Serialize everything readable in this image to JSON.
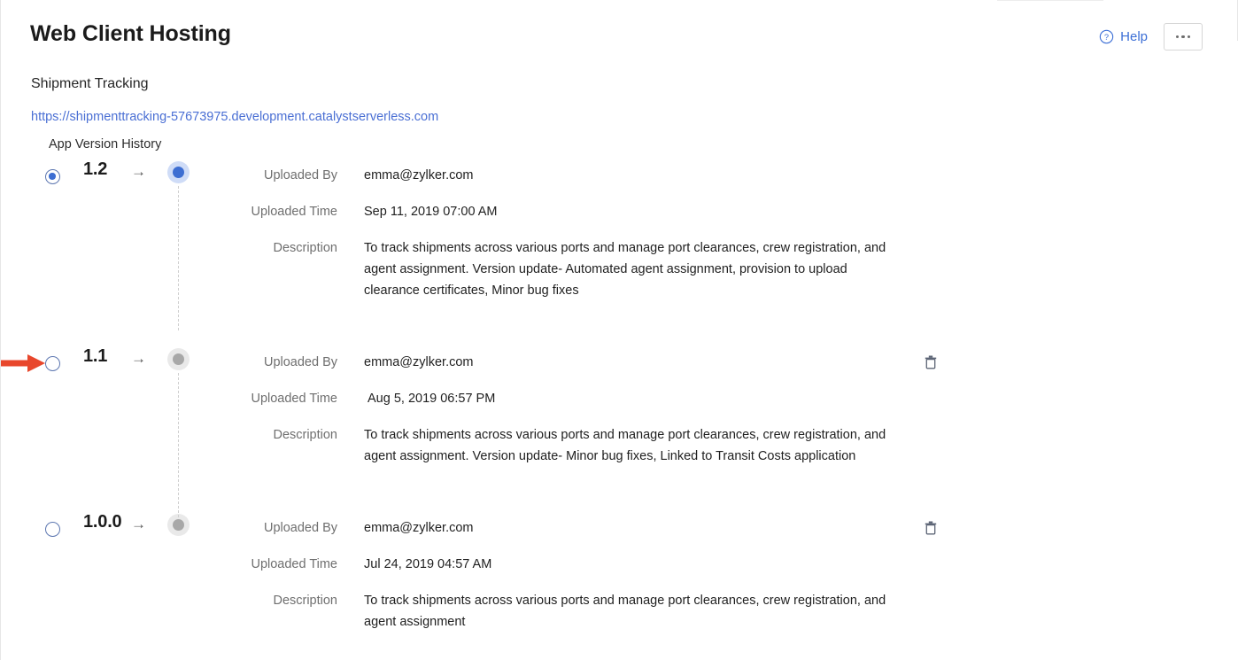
{
  "header": {
    "title": "Web Client Hosting",
    "help_label": "Help",
    "help_icon": "question-circle-icon",
    "more_icon": "ellipsis-icon"
  },
  "app": {
    "name": "Shipment Tracking",
    "url": "https://shipmenttracking-57673975.development.catalystserverless.com",
    "section_label": "App Version History"
  },
  "labels": {
    "uploaded_by": "Uploaded By",
    "uploaded_time": "Uploaded Time",
    "description": "Description",
    "arrow_glyph": "→",
    "delete_icon": "trash-icon"
  },
  "colors": {
    "link": "#4a6fd4",
    "accent": "#3d6ed2",
    "annotation": "#e8472c",
    "label_text": "#6f6f6f",
    "idle_dot": "#a8a8a8"
  },
  "versions": [
    {
      "version": "1.2",
      "selected": true,
      "active_dot": true,
      "uploaded_by": "emma@zylker.com",
      "uploaded_time": "Sep 11, 2019 07:00 AM",
      "description": "To track shipments across various ports and manage port clearances, crew registration, and agent assignment. Version update- Automated agent assignment, provision to upload clearance certificates, Minor bug fixes",
      "deletable": false,
      "annotated": false
    },
    {
      "version": "1.1",
      "selected": false,
      "active_dot": false,
      "uploaded_by": "emma@zylker.com",
      "uploaded_time": "Aug 5, 2019 06:57 PM",
      "description": "To track shipments across various ports and manage port clearances, crew registration, and agent assignment. Version update- Minor bug fixes, Linked to Transit Costs application",
      "deletable": true,
      "annotated": true
    },
    {
      "version": "1.0.0",
      "selected": false,
      "active_dot": false,
      "uploaded_by": "emma@zylker.com",
      "uploaded_time": "Jul 24, 2019 04:57 AM",
      "description": "To track shipments across various ports and manage port clearances, crew registration, and agent assignment",
      "deletable": true,
      "annotated": false
    }
  ]
}
